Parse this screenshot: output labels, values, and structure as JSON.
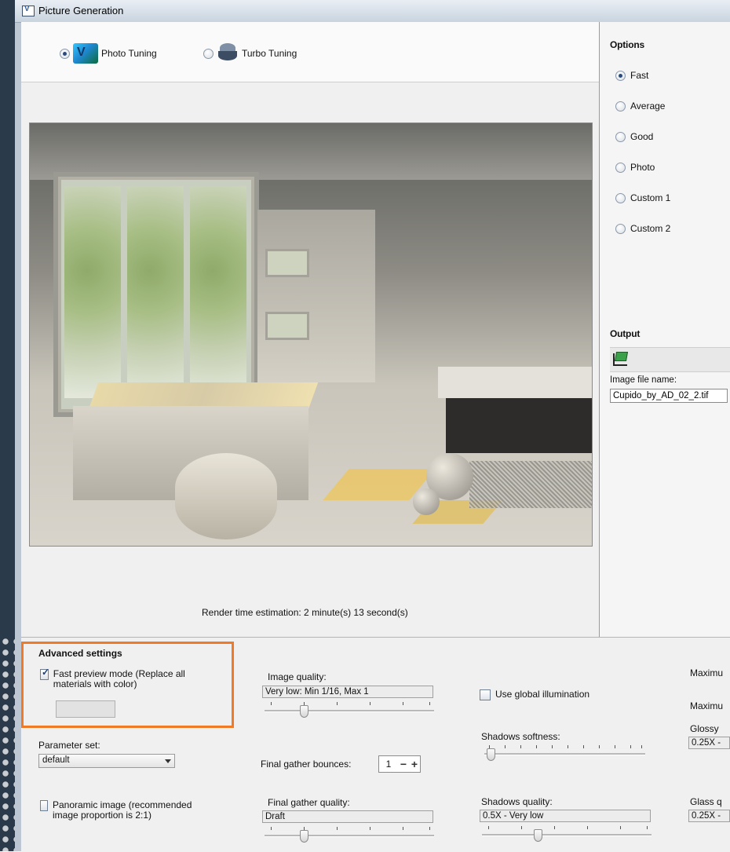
{
  "window": {
    "title": "Picture Generation"
  },
  "modes": [
    {
      "label": "Photo Tuning",
      "selected": true,
      "icon": "vray-photo-icon"
    },
    {
      "label": "Turbo Tuning",
      "selected": false,
      "icon": "teapot-icon"
    }
  ],
  "render_estimate": "Render time estimation: 2 minute(s) 13 second(s)",
  "options": {
    "heading": "Options",
    "items": [
      {
        "label": "Fast",
        "selected": true
      },
      {
        "label": "Average",
        "selected": false
      },
      {
        "label": "Good",
        "selected": false
      },
      {
        "label": "Photo",
        "selected": false
      },
      {
        "label": "Custom 1",
        "selected": false
      },
      {
        "label": "Custom 2",
        "selected": false
      }
    ]
  },
  "output": {
    "heading": "Output",
    "icon": "output-folder-icon",
    "file_label": "Image file name:",
    "file_value": "Cupido_by_AD_02_2.tif"
  },
  "advanced": {
    "heading": "Advanced settings",
    "fast_preview_label": "Fast preview mode (Replace all materials with color)",
    "fast_preview_checked": true,
    "parameter_set_label": "Parameter set:",
    "parameter_set_value": "default",
    "panoramic_label": "Panoramic image (recommended image proportion is 2:1)",
    "panoramic_checked": false,
    "image_quality_label": "Image quality:",
    "image_quality_value": "Very low: Min 1/16, Max 1",
    "final_gather_bounces_label": "Final gather bounces:",
    "final_gather_bounces_value": "1",
    "final_gather_quality_label": "Final gather quality:",
    "final_gather_quality_value": "Draft",
    "use_gi_label": "Use global illumination",
    "use_gi_checked": false,
    "shadows_softness_label": "Shadows softness:",
    "shadows_quality_label": "Shadows quality:",
    "shadows_quality_value": "0.5X - Very low",
    "max_label_1": "Maximu",
    "max_label_2": "Maximu",
    "glossy_label": "Glossy",
    "glossy_value": "0.25X -",
    "glass_label": "Glass q",
    "glass_value": "0.25X -"
  },
  "colors": {
    "highlight": "#f07a25",
    "selected_radio": "#2b4a7a"
  }
}
